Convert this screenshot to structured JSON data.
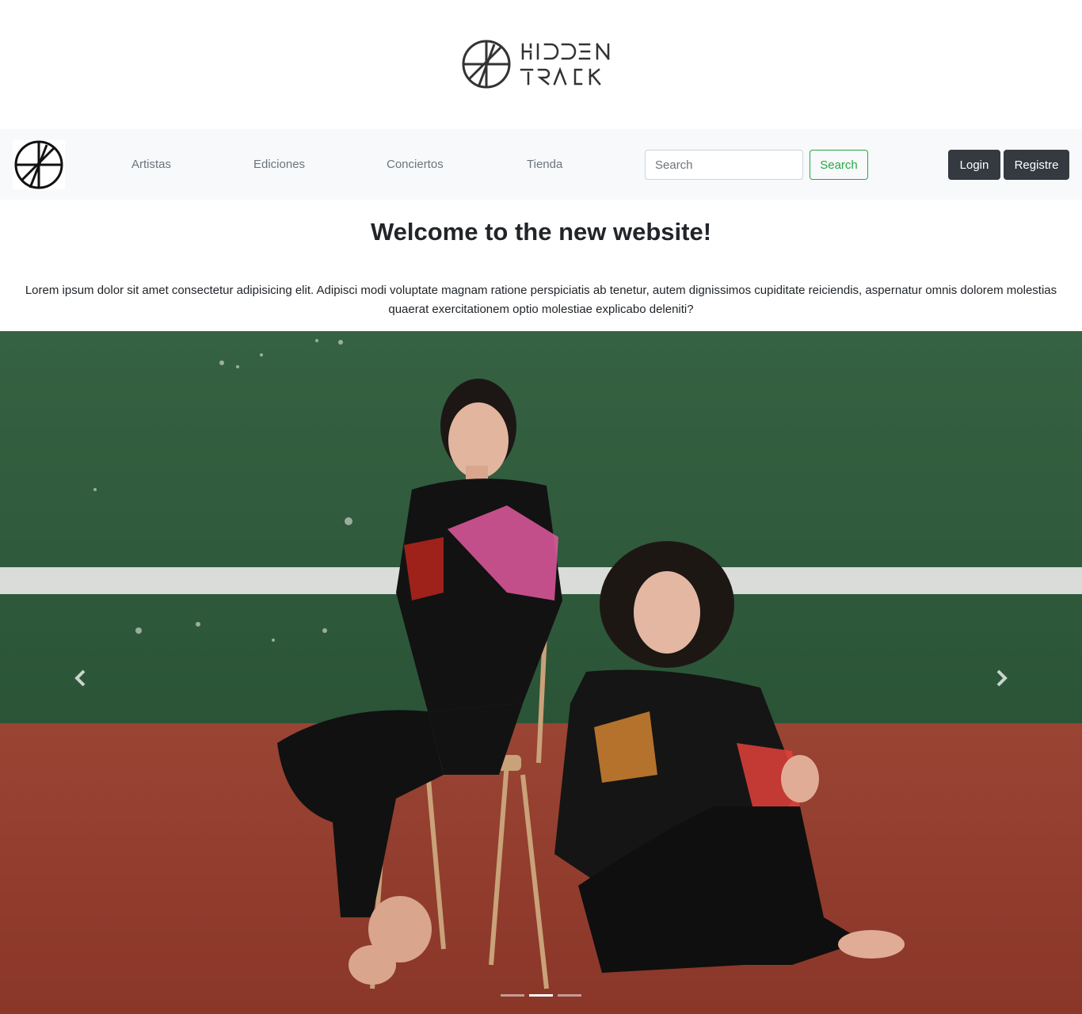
{
  "brand": {
    "logo_lines": [
      "HIDDEN",
      "TRACK"
    ]
  },
  "navbar": {
    "links": [
      {
        "label": "Artistas"
      },
      {
        "label": "Ediciones"
      },
      {
        "label": "Conciertos"
      },
      {
        "label": "Tienda"
      }
    ],
    "search": {
      "placeholder": "Search",
      "value": "",
      "button_label": "Search"
    },
    "login_label": "Login",
    "register_label": "Registre"
  },
  "welcome": {
    "title": "Welcome to the new website!",
    "text": "Lorem ipsum dolor sit amet consectetur adipisicing elit. Adipisci modi voluptate magnam ratione perspiciatis ab tenetur, autem dignissimos cupiditate reiciendis, aspernatur omnis dolorem molestias quaerat exercitationem optio molestiae explicabo deleniti?"
  },
  "carousel": {
    "slide_count": 3,
    "active_index": 1,
    "image_description": "two women in dark patterned outfits, one sitting on a wooden chair, the other sitting on a red floor, in front of a green wall with a white stripe"
  },
  "colors": {
    "navbar_bg": "#f8f9fa",
    "success": "#28a745",
    "dark": "#343a40",
    "muted": "#6c757d",
    "wall_green": "#2f5a3b",
    "floor_red": "#8e3b2d"
  },
  "icons": {
    "prev": "chevron-left-icon",
    "next": "chevron-right-icon",
    "logo": "hidden-track-logo-icon"
  }
}
